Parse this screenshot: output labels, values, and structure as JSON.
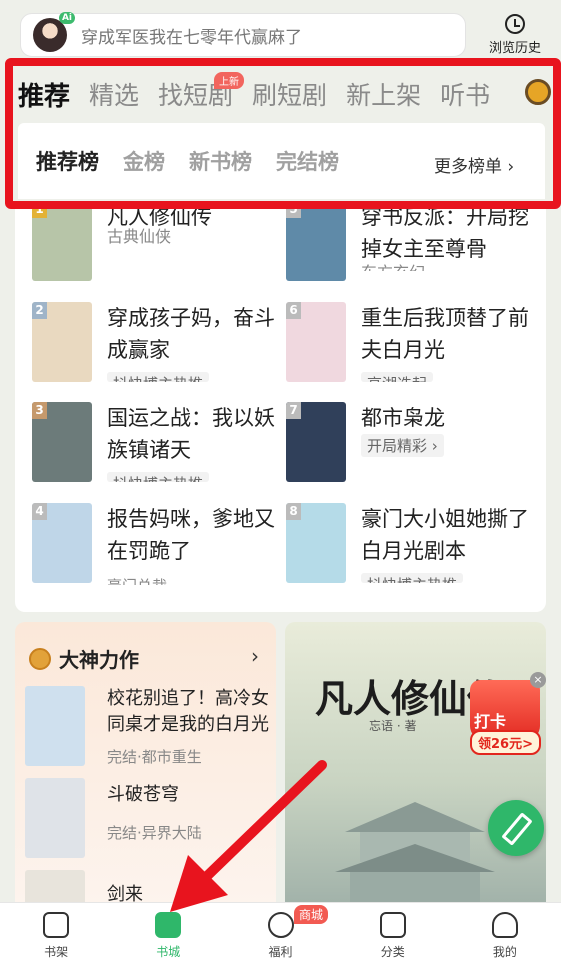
{
  "search": {
    "placeholder_text": "穿成军医我在七零年代赢麻了",
    "ai_badge": "Ai"
  },
  "history": {
    "label": "浏览历史"
  },
  "tabs": [
    {
      "label": "推荐"
    },
    {
      "label": "精选"
    },
    {
      "label": "找短剧",
      "badge": "上新"
    },
    {
      "label": "刷短剧"
    },
    {
      "label": "新上架"
    },
    {
      "label": "听书"
    }
  ],
  "subtabs": [
    {
      "label": "推荐榜"
    },
    {
      "label": "金榜"
    },
    {
      "label": "新书榜"
    },
    {
      "label": "完结榜"
    }
  ],
  "more_rankings": "更多榜单 ›",
  "ranking": [
    {
      "rank": "1",
      "title": "凡人修仙传",
      "sub": "古典仙侠",
      "cover": "#b7c5a8"
    },
    {
      "rank": "2",
      "title": "穿成孩子妈，奋斗成赢家",
      "sub": "抖快博主热推",
      "cover": "#e9d9c0"
    },
    {
      "rank": "3",
      "title": "国运之战：我以妖族镇诸天",
      "sub": "抖快博主热推",
      "cover": "#6c7b7a"
    },
    {
      "rank": "4",
      "title": "报告妈咪，爹地又在罚跪了",
      "sub": "豪门总裁",
      "cover": "#bfd6e8"
    },
    {
      "rank": "5",
      "title": "穿书反派：开局挖掉女主至尊骨",
      "sub": "东方玄幻",
      "cover": "#5f8aa8"
    },
    {
      "rank": "6",
      "title": "重生后我顶替了前夫白月光",
      "sub": "高湖迭起",
      "cover": "#f0d8df"
    },
    {
      "rank": "7",
      "title": "都市枭龙",
      "sub": "开局精彩 ›",
      "cover": "#30405a"
    },
    {
      "rank": "8",
      "title": "豪门大小姐她撕了白月光剧本",
      "sub": "抖快博主热推",
      "cover": "#b5dbe8"
    }
  ],
  "god": {
    "title": "大神力作",
    "arrow": "›",
    "items": [
      {
        "title": "校花别追了！高冷女同桌才是我的白月光",
        "sub": "完结·都市重生",
        "cover": "#cfe0ee"
      },
      {
        "title": "斗破苍穹",
        "sub": "完结·异界大陆",
        "cover": "#dfe3e8"
      },
      {
        "title": "剑来",
        "sub": "",
        "cover": "#e8e4dc"
      }
    ]
  },
  "feature": {
    "title": "凡人修仙传",
    "author": "忘语 · 著"
  },
  "checkin": {
    "label": "打卡",
    "amount": "领26元>",
    "close": "×"
  },
  "nav": [
    {
      "label": "书架",
      "active": false
    },
    {
      "label": "书城",
      "active": true
    },
    {
      "label": "福利",
      "badge": "商城",
      "active": false
    },
    {
      "label": "分类",
      "active": false
    },
    {
      "label": "我的",
      "active": false
    }
  ]
}
